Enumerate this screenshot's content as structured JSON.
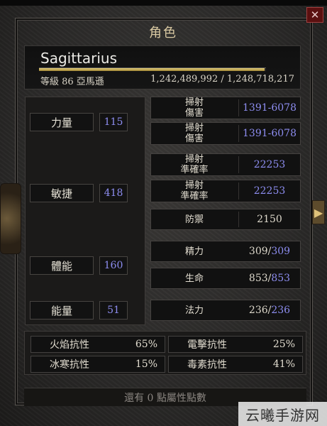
{
  "window": {
    "title": "角色",
    "close_icon": "close-icon"
  },
  "character": {
    "name": "Sagittarius",
    "level_line": "等級 86 亞馬遜",
    "xp_text": "1,242,489,992 / 1,248,718,217",
    "xp_progress": 0.995
  },
  "attributes": [
    {
      "label": "力量",
      "value": "115"
    },
    {
      "label": "敏捷",
      "value": "418"
    },
    {
      "label": "體能",
      "value": "160"
    },
    {
      "label": "能量",
      "value": "51"
    }
  ],
  "combat": {
    "damage1": {
      "label": "掃射\n傷害",
      "value": "1391-6078"
    },
    "damage2": {
      "label": "掃射\n傷害",
      "value": "1391-6078"
    },
    "attack1": {
      "label": "掃射\n準確率",
      "value": "22253"
    },
    "attack2": {
      "label": "掃射\n準確率",
      "value": "22253"
    },
    "defense": {
      "label": "防禦",
      "value": "2150"
    },
    "stamina": {
      "label": "精力",
      "current": "309",
      "max": "309"
    },
    "life": {
      "label": "生命",
      "current": "853",
      "max": "853"
    },
    "mana": {
      "label": "法力",
      "current": "236",
      "max": "236"
    }
  },
  "resistances": [
    {
      "label": "火焰抗性",
      "value": "65%"
    },
    {
      "label": "電擊抗性",
      "value": "25%"
    },
    {
      "label": "冰寒抗性",
      "value": "15%"
    },
    {
      "label": "毒素抗性",
      "value": "41%"
    }
  ],
  "footer": {
    "text": "還有 0 點屬性點數"
  },
  "nav": {
    "arrow": "▶"
  },
  "watermark": {
    "text": "云曦手游网"
  },
  "colors": {
    "accent_blue": "#8d8df0",
    "title_gold": "#d9c9a2"
  }
}
